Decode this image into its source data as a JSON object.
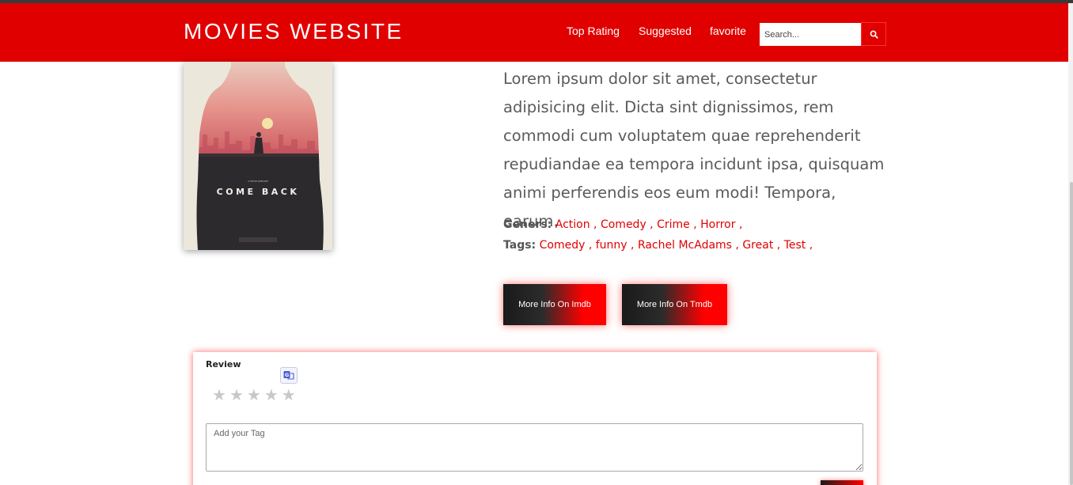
{
  "nav": {
    "brand": "MOVIES WEBSITE",
    "links": [
      "Top Rating",
      "Suggested",
      "favorite"
    ],
    "search_placeholder": "Search...",
    "search_icon": "search-icon"
  },
  "movie": {
    "poster_title": "COME BACK",
    "poster_credit": "A FILM BY JOHN DOE",
    "description": "Lorem ipsum dolor sit amet, consectetur adipisicing elit. Dicta sint dignissimos, rem commodi cum voluptatem quae reprehenderit repudiandae ea tempora incidunt ipsa, quisquam animi perferendis eos eum modi! Tempora, earum.",
    "genres_label": "Geners:",
    "genres": [
      "Action",
      "Comedy",
      "Crime",
      "Horror"
    ],
    "tags_label": "Tags:",
    "tags": [
      "Comedy",
      "funny",
      "Rachel McAdams",
      "Great",
      "Test"
    ]
  },
  "buttons": {
    "imdb": "More Info On Imdb",
    "tmdb": "More Info On Tmdb"
  },
  "review": {
    "title": "Review",
    "rating": 0,
    "max_rating": 5,
    "star_glyph": "★",
    "translate_icon": "translate-icon",
    "tag_placeholder": "Add your Tag"
  },
  "colors": {
    "primary": "#e00000",
    "text": "#5a5a5a",
    "star_empty": "#c8c8c8"
  }
}
